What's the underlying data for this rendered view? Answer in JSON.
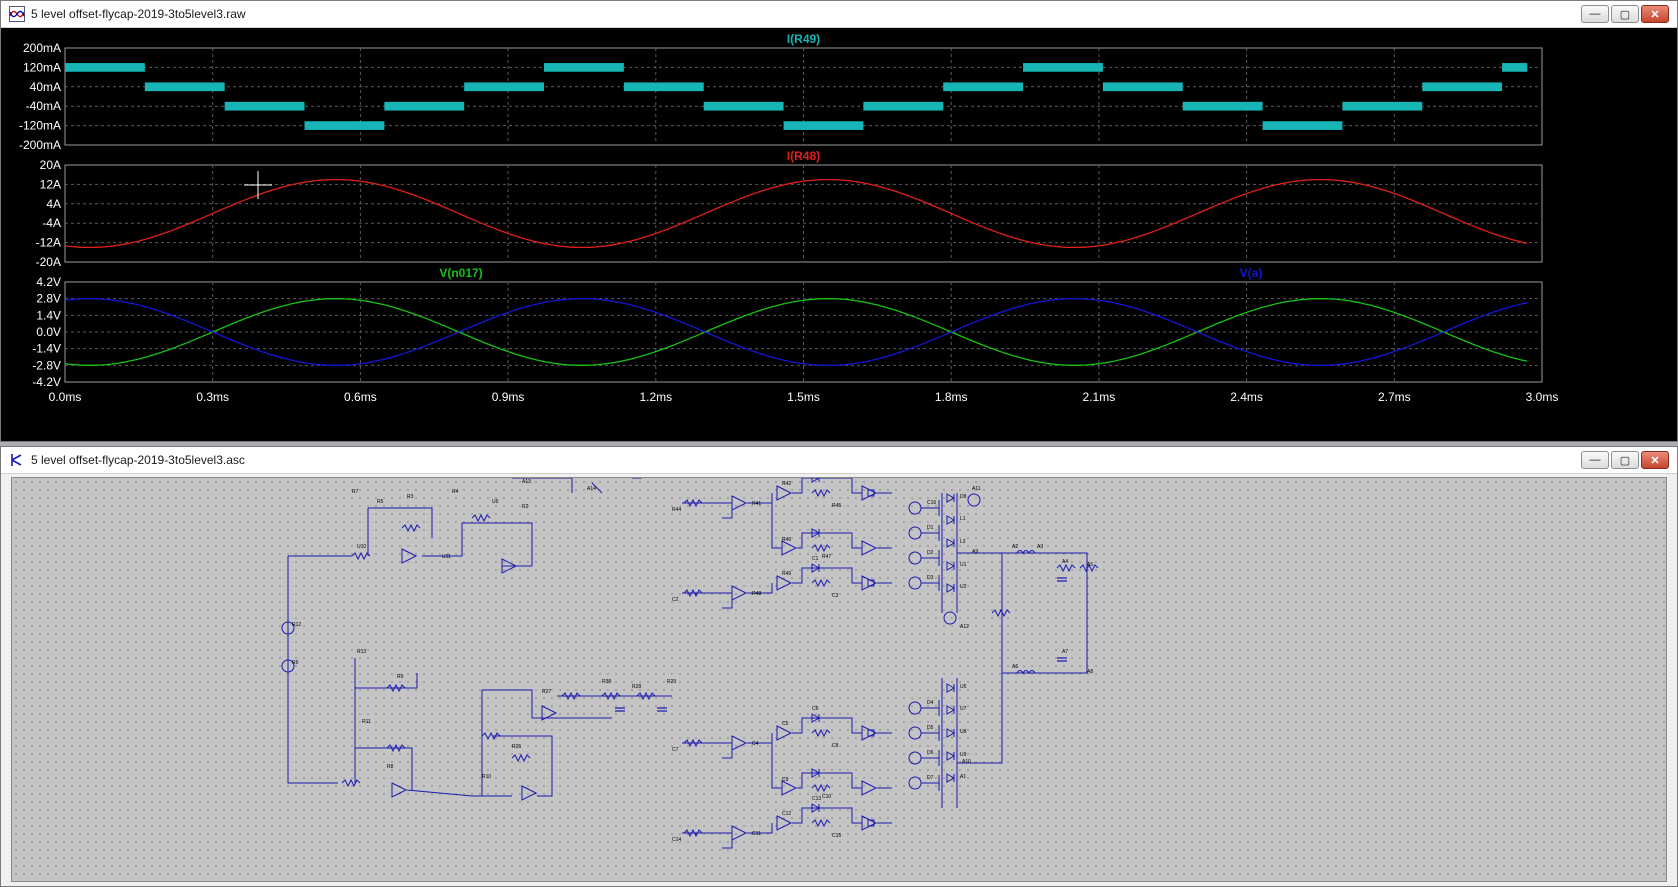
{
  "plot_window": {
    "title": "5 level offset-flycap-2019-3to5level3.raw",
    "buttons": {
      "minimize": "—",
      "maximize": "▢",
      "close": "✕"
    }
  },
  "schematic_window": {
    "title": "5 level offset-flycap-2019-3to5level3.asc",
    "buttons": {
      "minimize": "—",
      "maximize": "▢",
      "close": "✕"
    }
  },
  "colors": {
    "plot_bg": "#000000",
    "grid": "#5a5a5a",
    "axis_text": "#ffffff",
    "i_r49": "#17b5b5",
    "i_r48": "#e0201a",
    "v_n017": "#16c216",
    "v_a": "#1515d6",
    "wire": "#1a1ab0"
  },
  "chart_data": [
    {
      "type": "line",
      "title": "I(R49)",
      "series": [
        {
          "name": "I(R49)",
          "color": "#17b5b5",
          "note_style": "staircase band",
          "levels_mA": [
            120,
            40,
            -40,
            -120,
            -40,
            40,
            120,
            40,
            -40,
            -120,
            -40,
            40,
            120,
            40,
            -40,
            -120,
            -40,
            40,
            120
          ]
        }
      ],
      "x_range_ms": [
        0,
        3.0
      ],
      "ylim": [
        -200,
        200
      ],
      "y_ticks": [
        "200mA",
        "120mA",
        "40mA",
        "-40mA",
        "-120mA",
        "-200mA"
      ]
    },
    {
      "type": "line",
      "title": "I(R48)",
      "series": [
        {
          "name": "I(R48)",
          "color": "#e0201a",
          "amplitude": 14,
          "period_ms": 1.0,
          "peak_ms": 0.55
        }
      ],
      "x_range_ms": [
        0,
        3.0
      ],
      "ylim": [
        -20,
        20
      ],
      "y_ticks": [
        "20A",
        "12A",
        "4A",
        "-4A",
        "-12A",
        "-20A"
      ]
    },
    {
      "type": "line",
      "series": [
        {
          "name": "V(n017)",
          "color": "#16c216",
          "amplitude": 2.8,
          "period_ms": 1.0,
          "peak_ms": 0.55
        },
        {
          "name": "V(a)",
          "color": "#1515d6",
          "amplitude": 2.8,
          "period_ms": 1.0,
          "peak_ms": 0.05
        }
      ],
      "x_range_ms": [
        0,
        3.0
      ],
      "ylim": [
        -4.2,
        4.2
      ],
      "y_ticks": [
        "4.2V",
        "2.8V",
        "1.4V",
        "0.0V",
        "-1.4V",
        "-2.8V",
        "-4.2V"
      ]
    }
  ],
  "x_ticks": [
    "0.0ms",
    "0.3ms",
    "0.6ms",
    "0.9ms",
    "1.2ms",
    "1.5ms",
    "1.8ms",
    "2.1ms",
    "2.4ms",
    "2.7ms",
    "3.0ms"
  ],
  "schematic_labels": [
    "R12",
    "R6",
    "R7",
    "R5",
    "R3",
    "R4",
    "U6",
    "R2",
    "U10",
    "U11",
    "R13",
    "R11",
    "R9",
    "R8",
    "R10",
    "R26",
    "R27",
    "R38",
    "R28",
    "R29",
    "R41",
    "R42",
    "R43",
    "R44",
    "R45",
    "R46",
    "R47",
    "R48",
    "R49",
    "C1",
    "C2",
    "C3",
    "C4",
    "C5",
    "C6",
    "C7",
    "C8",
    "C9",
    "C10",
    "C11",
    "C12",
    "C13",
    "C14",
    "C15",
    "C16",
    "D1",
    "D2",
    "D3",
    "D4",
    "D5",
    "D6",
    "D7",
    "D8",
    "L1",
    "L2",
    "U1",
    "U2",
    "U5",
    "U7",
    "U8",
    "U9",
    "A1",
    "A2",
    "A3",
    "A4",
    "A5",
    "A6",
    "A7",
    "A8",
    "A9",
    "A10",
    "A11",
    "A12",
    "A13",
    "A14",
    "A15",
    "A16",
    "V1",
    "V2",
    "V3",
    "V4"
  ]
}
